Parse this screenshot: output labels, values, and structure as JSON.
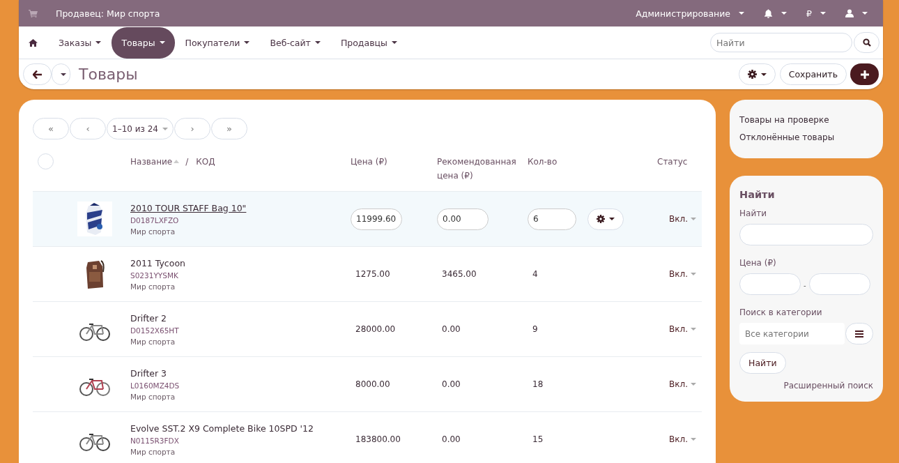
{
  "topbar": {
    "title": "Продавец: Мир спорта",
    "admin": "Администрирование",
    "currency": "₽"
  },
  "nav": {
    "items": [
      {
        "label": "Заказы",
        "selected": false
      },
      {
        "label": "Товары",
        "selected": true
      },
      {
        "label": "Покупатели",
        "selected": false
      },
      {
        "label": "Веб-сайт",
        "selected": false
      },
      {
        "label": "Продавцы",
        "selected": false
      }
    ],
    "search_placeholder": "Найти"
  },
  "toolbar": {
    "title": "Товары",
    "save": "Сохранить"
  },
  "pagination": {
    "first": "«",
    "prev": "‹",
    "range": "1–10 из 24",
    "next": "›",
    "last": "»"
  },
  "table": {
    "select_all_checked": false,
    "columns": {
      "name": "Название",
      "separator": "/",
      "code": "КОД",
      "price": "Цена (₽)",
      "list_price": "Рекомендованная цена (₽)",
      "quantity": "Кол-во",
      "status": "Статус"
    },
    "rows": [
      {
        "kind": "picture",
        "name": "2010 TOUR STAFF Bag 10\"",
        "code": "D0187LXFZO",
        "vendor": "Мир спорта",
        "price": "11999.60",
        "list_price": "0.00",
        "quantity": "6",
        "status": "Вкл.",
        "hovered": true
      },
      {
        "kind": "picture",
        "name": "2011 Tycoon",
        "code": "S0231YYSMK",
        "vendor": "Мир спорта",
        "price": "1275.00",
        "list_price": "3465.00",
        "quantity": "4",
        "status": "Вкл.",
        "hovered": false
      },
      {
        "kind": "picture",
        "name": "Drifter 2",
        "code": "D0152X65HT",
        "vendor": "Мир спорта",
        "price": "28000.00",
        "list_price": "0.00",
        "quantity": "9",
        "status": "Вкл.",
        "hovered": false
      },
      {
        "kind": "picture",
        "name": "Drifter 3",
        "code": "L0160MZ4DS",
        "vendor": "Мир спорта",
        "price": "8000.00",
        "list_price": "0.00",
        "quantity": "18",
        "status": "Вкл.",
        "hovered": false
      },
      {
        "kind": "picture",
        "name": "Evolve SST.2 X9 Complete Bike 10SPD '12",
        "code": "N0115R3FDX",
        "vendor": "Мир спорта",
        "price": "183800.00",
        "list_price": "0.00",
        "quantity": "15",
        "status": "Вкл.",
        "hovered": false
      }
    ]
  },
  "sidebar": {
    "links": [
      "Товары на проверке",
      "Отклонённые товары"
    ],
    "search": {
      "title": "Найти",
      "find_label": "Найти",
      "price_label": "Цена (₽)",
      "price_dash": "-",
      "category_label": "Поиск в категории",
      "category_placeholder": "Все категории",
      "submit": "Найти",
      "advanced": "Расширенный поиск"
    }
  }
}
